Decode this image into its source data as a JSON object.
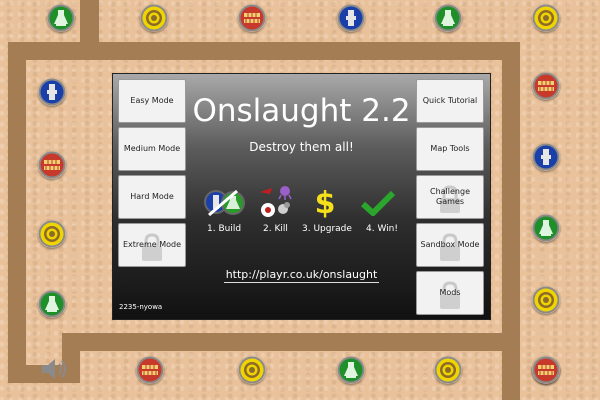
{
  "title": "Onslaught 2.2",
  "tagline": "Destroy them all!",
  "left_menu": [
    {
      "label": "Easy Mode",
      "locked": false
    },
    {
      "label": "Medium Mode",
      "locked": false
    },
    {
      "label": "Hard Mode",
      "locked": false
    },
    {
      "label": "Extreme Mode",
      "locked": true
    }
  ],
  "right_menu": [
    {
      "label": "Quick Tutorial",
      "locked": false
    },
    {
      "label": "Map Tools",
      "locked": false
    },
    {
      "label": "Challenge Games",
      "locked": true
    },
    {
      "label": "Sandbox Mode",
      "locked": true
    },
    {
      "label": "Mods",
      "locked": true
    }
  ],
  "steps": [
    {
      "label": "1. Build",
      "icon": "build-towers-icon"
    },
    {
      "label": "2. Kill",
      "icon": "enemies-icon"
    },
    {
      "label": "3. Upgrade",
      "icon": "dollar-icon"
    },
    {
      "label": "4. Win!",
      "icon": "checkmark-icon"
    }
  ],
  "url": "http://playr.co.uk/onslaught",
  "build_id": "2235-nyowa",
  "sound_icon": "speaker-icon",
  "colors": {
    "background": "#e9c29b",
    "path": "#a57d55",
    "dollar": "#f3e01b",
    "check": "#2ca52c"
  },
  "towers": [
    {
      "type": "flask"
    },
    {
      "type": "sun"
    },
    {
      "type": "bricks"
    },
    {
      "type": "blue"
    },
    {
      "type": "flask"
    },
    {
      "type": "sun"
    },
    {
      "type": "blue"
    },
    {
      "type": "bricks"
    },
    {
      "type": "sun"
    },
    {
      "type": "flask"
    },
    {
      "type": "bricks"
    },
    {
      "type": "blue"
    },
    {
      "type": "flask"
    },
    {
      "type": "sun"
    },
    {
      "type": "sun"
    },
    {
      "type": "bricks"
    },
    {
      "type": "sun"
    },
    {
      "type": "flask"
    },
    {
      "type": "sun"
    },
    {
      "type": "bricks"
    }
  ]
}
